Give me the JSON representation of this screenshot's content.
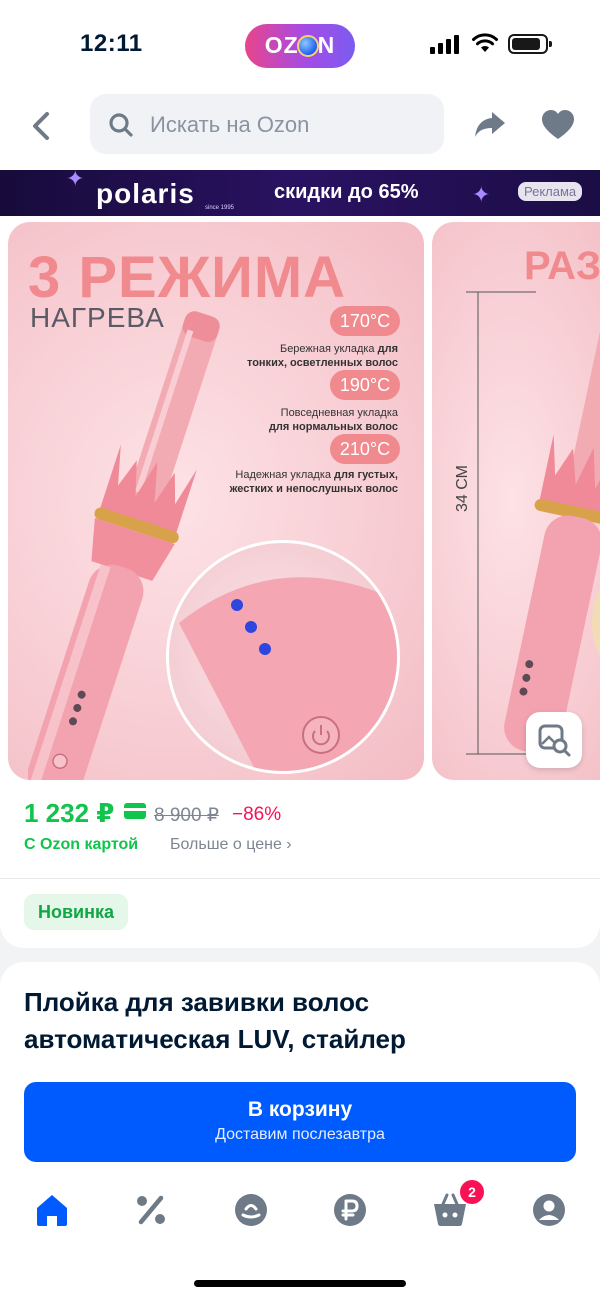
{
  "status_bar": {
    "time": "12:11",
    "brand_pill": "OZON"
  },
  "header": {
    "search_placeholder": "Искать на Ozon"
  },
  "ad_banner": {
    "brand": "polaris",
    "brand_sub": "since 1995",
    "text": "скидки до 65%",
    "label": "Реклама"
  },
  "gallery": {
    "slide1": {
      "headline": "3 РЕЖИМА",
      "subheadline": "НАГРЕВА",
      "modes": [
        {
          "temp": "170°C",
          "desc_plain": "Бережная укладка ",
          "desc_bold_1": "для",
          "desc_bold_2": "тонких, осветленных волос"
        },
        {
          "temp": "190°C",
          "desc_plain": "Повседневная укладка",
          "desc_bold_1": "",
          "desc_bold_2": "для нормальных волос"
        },
        {
          "temp": "210°C",
          "desc_plain": "Надежная укладка ",
          "desc_bold_1": "для густых,",
          "desc_bold_2": "жестких и непослушных волос"
        }
      ]
    },
    "slide2": {
      "headline": "РАЗ",
      "dimension": "34 СМ"
    }
  },
  "price": {
    "main": "1 232 ₽",
    "old": "8 900 ₽",
    "discount": "−86%",
    "card_label": "С Ozon картой",
    "more_label": "Больше о цене ›",
    "badge": "Новинка"
  },
  "product": {
    "title": "Плойка для завивки волос автоматическая LUV, стайлер",
    "cart_label": "В корзину",
    "cart_sub": "Доставим послезавтра"
  },
  "tab_bar": {
    "items": [
      "home-icon",
      "percent-icon",
      "fresh-icon",
      "ruble-icon",
      "cart-icon",
      "profile-icon"
    ],
    "cart_count": "2"
  },
  "colors": {
    "accent": "#005bff",
    "price_green": "#10c44c",
    "discount_red": "#f91155",
    "slide_pink": "#f08a8e"
  }
}
